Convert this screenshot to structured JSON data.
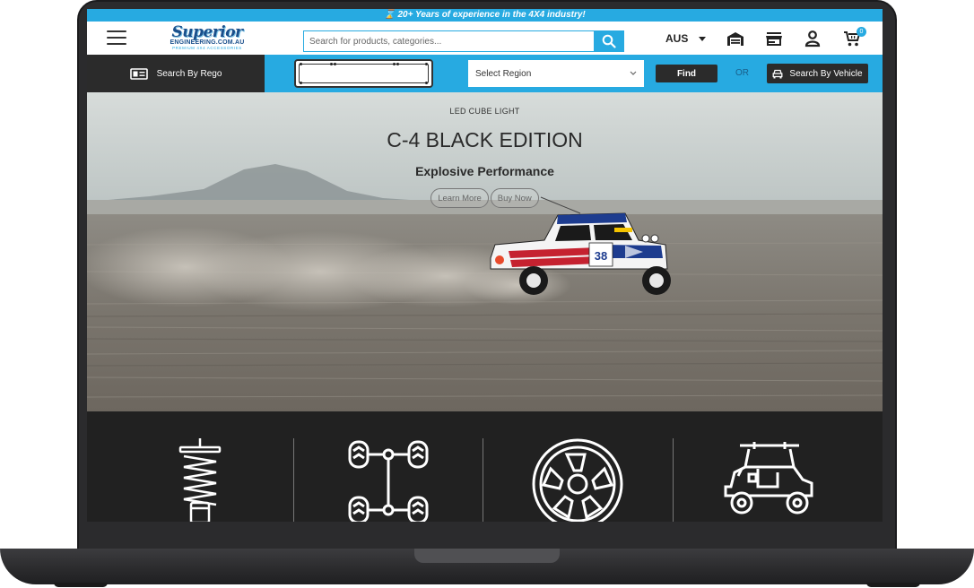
{
  "promo": {
    "icon": "hourglass-icon",
    "text": "⌛ 20+ Years of experience in the 4X4 industry!"
  },
  "header": {
    "logo": {
      "script": "Superior",
      "domain": "ENGINEERING.COM.AU",
      "tagline": "PREMIUM 4X4 ACCESSORIES"
    },
    "search_placeholder": "Search for products, categories...",
    "country": "AUS",
    "cart_count": "0",
    "icons": [
      "menu-icon",
      "search-icon",
      "garage-icon",
      "store-icon",
      "account-icon",
      "cart-icon"
    ]
  },
  "search_bar": {
    "rego_label": "Search By Rego",
    "region_placeholder": "Select Region",
    "find_label": "Find",
    "or_label": "OR",
    "vehicle_label": "Search By Vehicle"
  },
  "hero": {
    "kicker": "LED CUBE LIGHT",
    "title": "C-4 BLACK EDITION",
    "subtitle": "Explosive Performance",
    "learn_more": "Learn More",
    "buy_now": "Buy Now",
    "car_number": "38"
  },
  "categories": [
    {
      "icon": "suspension-icon"
    },
    {
      "icon": "chassis-icon"
    },
    {
      "icon": "wheel-icon"
    },
    {
      "icon": "vehicle-icon"
    }
  ],
  "colors": {
    "accent": "#27aae1",
    "dark": "#2b2b2b",
    "category_bg": "#212121"
  }
}
